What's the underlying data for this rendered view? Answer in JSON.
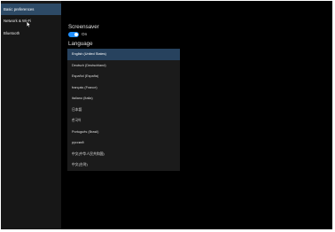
{
  "sidebar": {
    "items": [
      {
        "label": "Basic preferences",
        "active": true
      },
      {
        "label": "Network & Wi-Fi",
        "active": false
      },
      {
        "label": "Bluetooth",
        "active": false
      }
    ]
  },
  "main": {
    "screensaver": {
      "title": "Screensaver",
      "toggle_state": "On"
    },
    "language": {
      "label": "Language",
      "selected": "English (United States)",
      "options": [
        "English (United States)",
        "Deutsch (Deutschland)",
        "Español (España)",
        "français (France)",
        "italiano (Italia)",
        "日本語",
        "한국어",
        "Português (Brasil)",
        "русский",
        "中文(中华人民共和国)",
        "中文(台灣)"
      ]
    }
  },
  "colors": {
    "accent": "#1f8fff",
    "selected_bg": "#27425e",
    "sidebar_active_bg": "#2d4a66",
    "background": "#000000",
    "sidebar_bg": "#171717"
  },
  "icons": {
    "cursor": "mouse-pointer-icon"
  }
}
